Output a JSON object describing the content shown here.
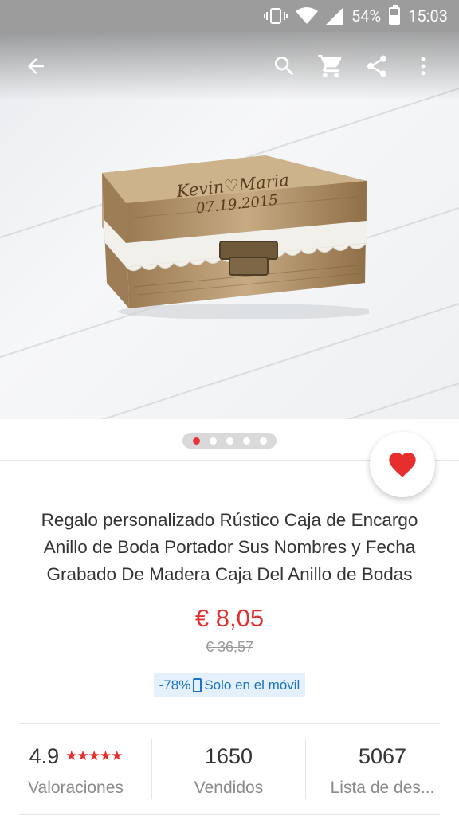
{
  "status_bar": {
    "battery": "54%",
    "time": "15:03"
  },
  "app_bar": {
    "icons": [
      "back-arrow-icon",
      "search-icon",
      "cart-icon",
      "share-icon",
      "more-vert-icon"
    ]
  },
  "hero": {
    "engraving_line1": "Kevin♡Maria",
    "engraving_line2": "07.19.2015"
  },
  "pager": {
    "count": 5,
    "active": 1
  },
  "product": {
    "title_line1": "Regalo personalizado Rústico Caja de Encargo",
    "title_line2": "Anillo de Boda Portador Sus Nombres y Fecha",
    "title_line3": "Grabado De Madera Caja Del Anillo de Bodas",
    "price": "€ 8,05",
    "old_price": "€ 36,57",
    "discount": "-78%",
    "mobile_only": "Solo en el móvil"
  },
  "stats": {
    "rating": "4.9",
    "stars": "★★★★★",
    "rating_label": "Valoraciones",
    "sold": "1650",
    "sold_label": "Vendidos",
    "wishlist": "5067",
    "wishlist_label": "Lista de des..."
  },
  "colors": {
    "accent": "#e62e2e",
    "badge_bg": "#e4f0fb",
    "badge_text": "#1a73c8",
    "status_bar": "#9c9c9c"
  }
}
